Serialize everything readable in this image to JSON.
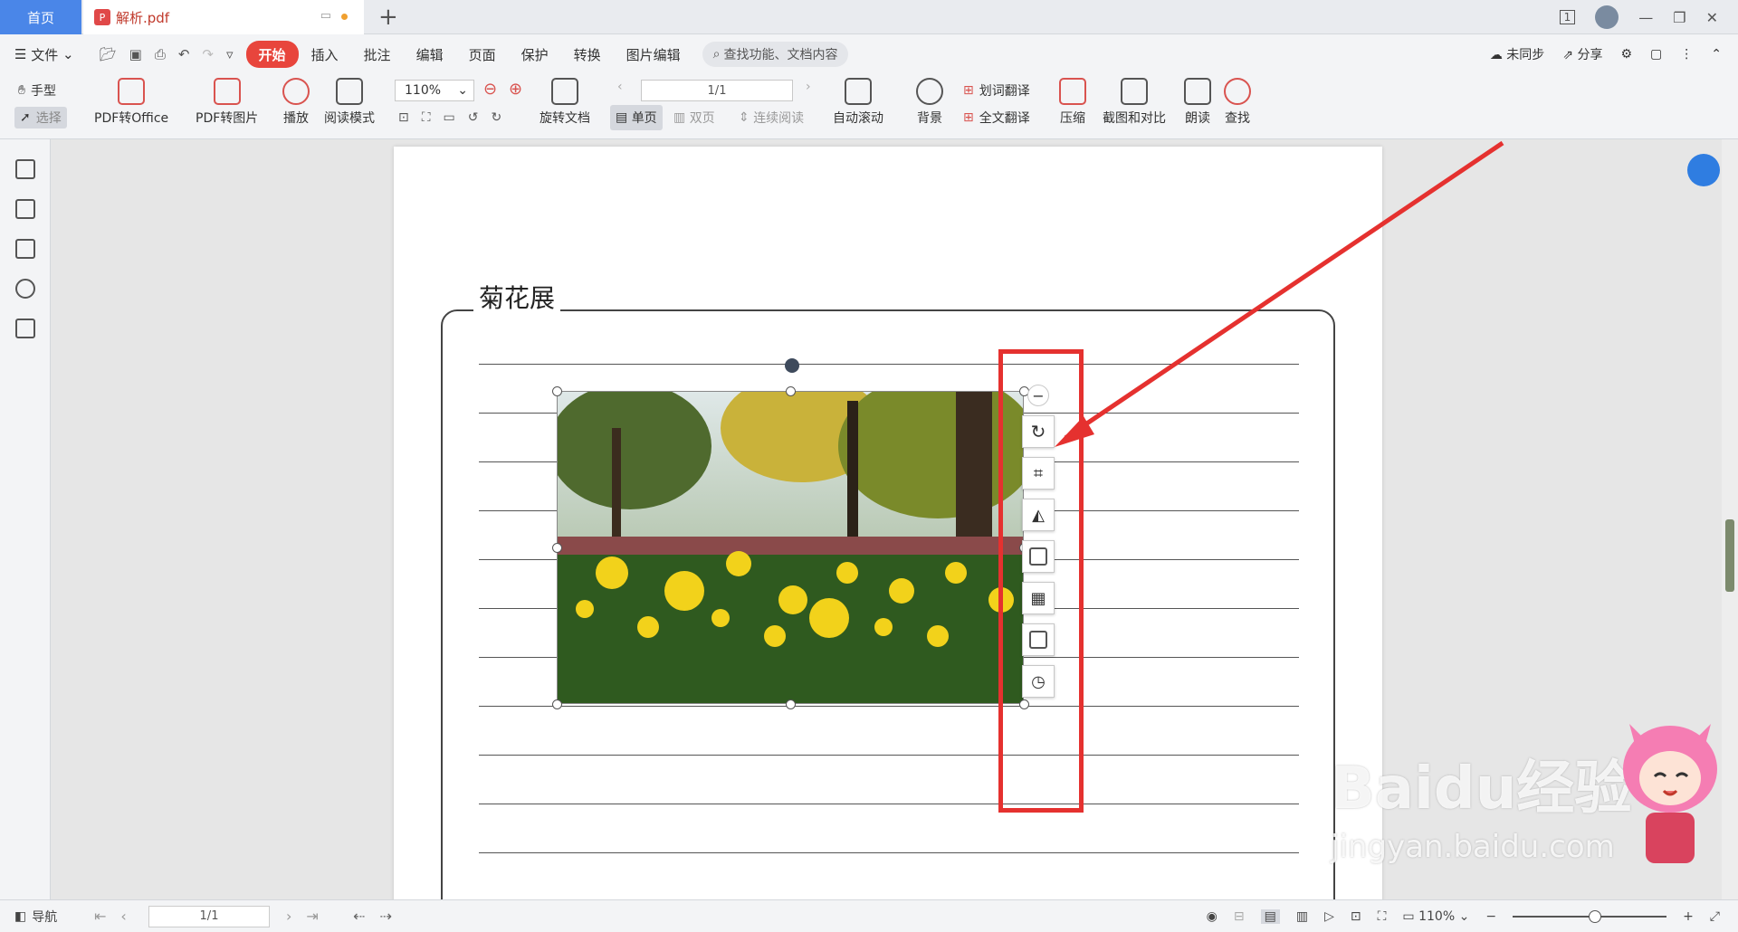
{
  "tabs": {
    "home": "首页",
    "doc": "解析.pdf",
    "doc_icon": "pdf-icon"
  },
  "window": {
    "page_indicator": "1",
    "controls": [
      "minimize-icon",
      "restore-icon",
      "close-icon"
    ]
  },
  "menu": {
    "file": "文件",
    "items": [
      "开始",
      "插入",
      "批注",
      "编辑",
      "页面",
      "保护",
      "转换",
      "图片编辑"
    ],
    "active": "开始",
    "search_placeholder": "查找功能、文档内容",
    "sync": "未同步",
    "share": "分享"
  },
  "toolbar": {
    "hand": "手型",
    "select": "选择",
    "pdf_to_office": "PDF转Office",
    "pdf_to_image": "PDF转图片",
    "play": "播放",
    "read_mode": "阅读模式",
    "zoom": "110%",
    "rotate_doc": "旋转文档",
    "page_current": "1",
    "page_total": "1",
    "single_page": "单页",
    "double_page": "双页",
    "continuous": "连续阅读",
    "auto_scroll": "自动滚动",
    "background": "背景",
    "word_translate": "划词翻译",
    "full_translate": "全文翻译",
    "compress": "压缩",
    "screenshot_compare": "截图和对比",
    "read_aloud": "朗读",
    "find": "查找"
  },
  "document": {
    "title": "菊花展",
    "image_tools": [
      "rotate-icon",
      "crop-icon",
      "flip-icon",
      "replace-icon",
      "transparency-icon",
      "extract-text-icon",
      "ocr-icon"
    ]
  },
  "statusbar": {
    "nav": "导航",
    "page": "1",
    "page_total": "1",
    "zoom": "110%"
  },
  "watermark": {
    "brand": "Baidu经验",
    "url": "jingyan.baidu.com"
  },
  "colors": {
    "accent": "#e8453c",
    "highlight_box": "#e5312f",
    "tab_active": "#4a86e8"
  }
}
